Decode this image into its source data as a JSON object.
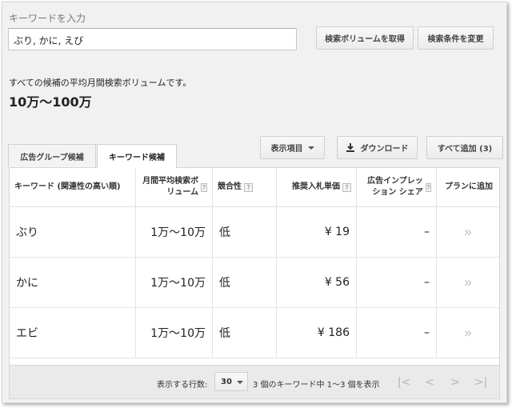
{
  "search": {
    "label": "キーワードを入力",
    "value": "ぶり, かに, えび",
    "btn_volume": "検索ボリュームを取得",
    "btn_edit": "検索条件を変更"
  },
  "summary": {
    "text": "すべての候補の平均月間検索ボリュームです。",
    "value": "10万〜100万"
  },
  "tabs": {
    "ad_group": "広告グループ候補",
    "keyword": "キーワード候補"
  },
  "toolbar": {
    "columns": "表示項目",
    "download": "ダウンロード",
    "add_all": "すべて追加 (3)"
  },
  "table": {
    "headers": {
      "keyword": "キーワード (関連性の高い順)",
      "volume": "月間平均検索ボリューム",
      "competition": "競合性",
      "bid": "推奨入札単価",
      "impression": "広告インプレッション シェア",
      "add": "プランに追加"
    },
    "help_glyph": "?",
    "rows": [
      {
        "keyword": "ぶり",
        "volume": "1万〜10万",
        "competition": "低",
        "bid": "¥ 19",
        "impression": "–",
        "add": "»"
      },
      {
        "keyword": "かに",
        "volume": "1万〜10万",
        "competition": "低",
        "bid": "¥ 56",
        "impression": "–",
        "add": "»"
      },
      {
        "keyword": "エビ",
        "volume": "1万〜10万",
        "competition": "低",
        "bid": "¥ 186",
        "impression": "–",
        "add": "»"
      }
    ]
  },
  "footer": {
    "rows_label": "表示する行数:",
    "rows_value": "30",
    "range_text": "3 個のキーワード中 1〜3 個を表示",
    "pager": {
      "first": "|<",
      "prev": "<",
      "next": ">",
      "last": ">|"
    }
  }
}
